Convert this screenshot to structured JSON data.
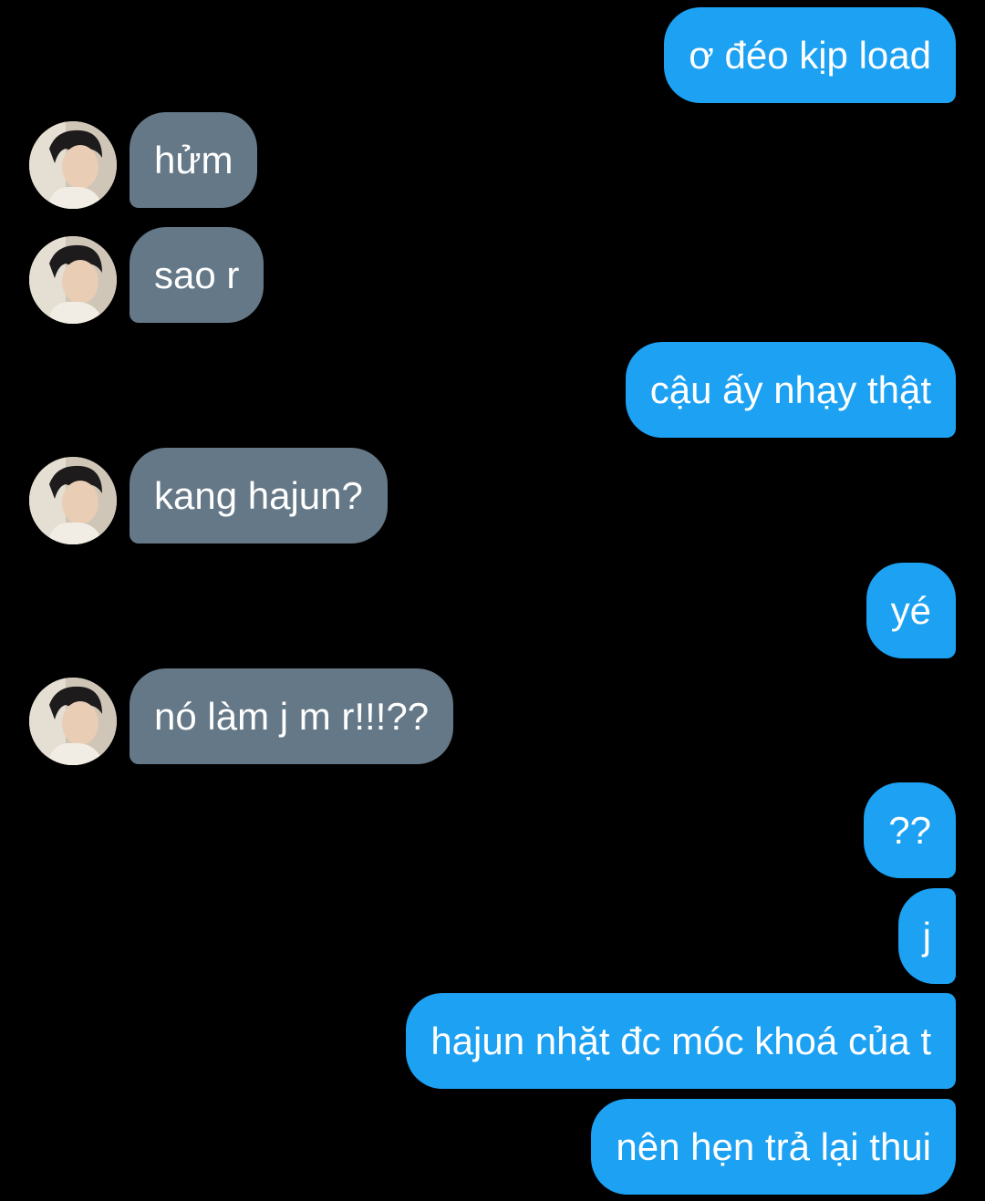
{
  "conversation": {
    "messages": [
      {
        "sender": "me",
        "text": "ơ đéo kịp load"
      },
      {
        "sender": "them",
        "text": "hửm"
      },
      {
        "sender": "them",
        "text": "sao r"
      },
      {
        "sender": "me",
        "text": "cậu ấy nhạy thật"
      },
      {
        "sender": "them",
        "text": "kang hajun?"
      },
      {
        "sender": "me",
        "text": "yé"
      },
      {
        "sender": "them",
        "text": "nó làm j m r!!!??"
      },
      {
        "sender": "me",
        "text": "??"
      },
      {
        "sender": "me",
        "text": "j"
      },
      {
        "sender": "me",
        "text": "hajun nhặt đc móc khoá của t"
      },
      {
        "sender": "me",
        "text": "nên hẹn trả lại thui"
      }
    ]
  },
  "colors": {
    "background": "#000000",
    "outgoing_bubble": "#1da1f2",
    "incoming_bubble": "#647887",
    "text": "#ffffff"
  },
  "icons": {
    "contact_avatar": "profile-photo-avatar"
  }
}
